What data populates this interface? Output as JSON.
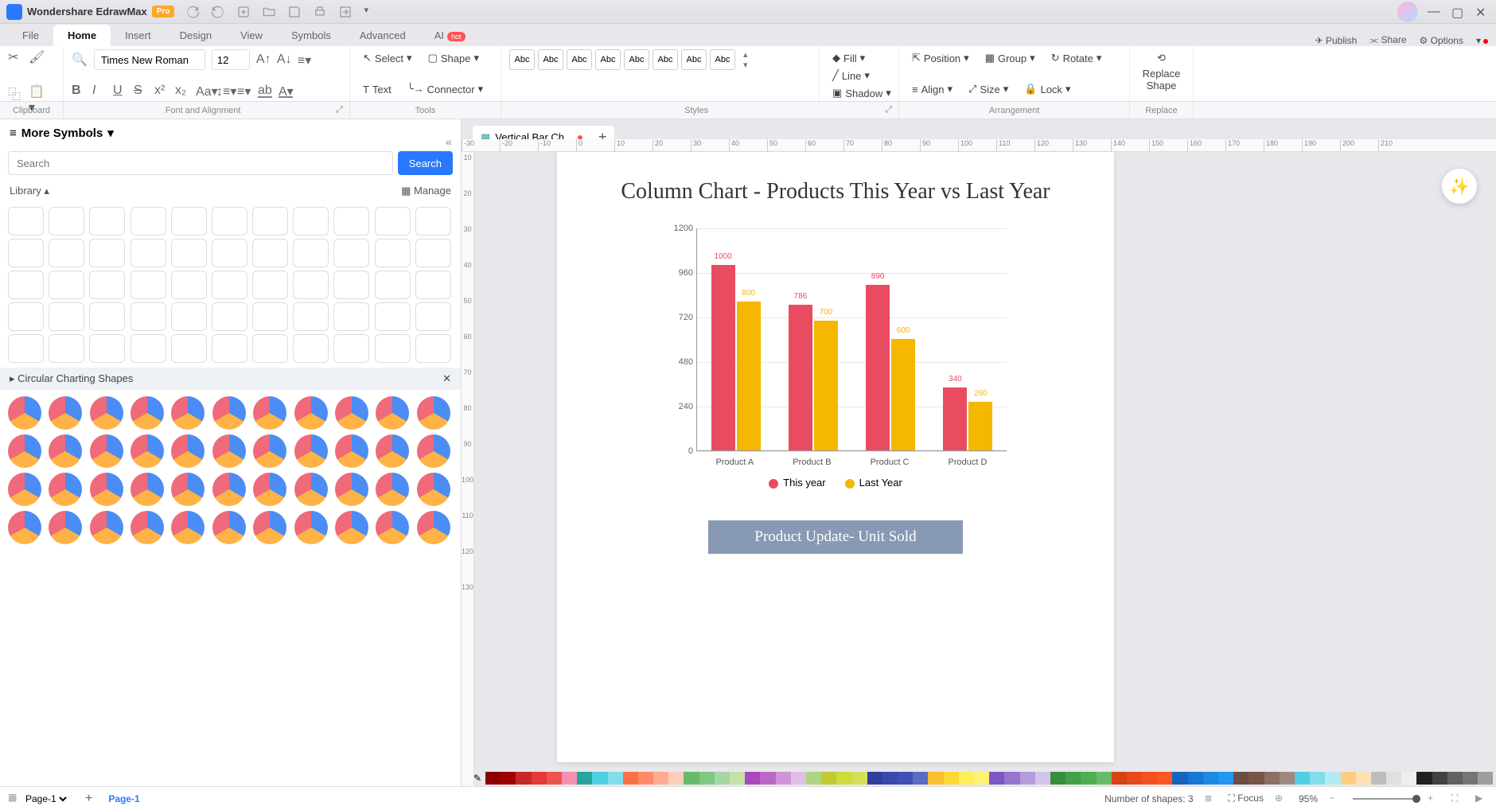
{
  "app": {
    "title": "Wondershare EdrawMax",
    "badge": "Pro"
  },
  "titlebar_actions_right": {
    "publish": "Publish",
    "share": "Share",
    "options": "Options"
  },
  "tabs": {
    "items": [
      "File",
      "Home",
      "Insert",
      "Design",
      "View",
      "Symbols",
      "Advanced",
      "AI"
    ],
    "active": "Home",
    "hot": "hot"
  },
  "ribbon": {
    "font_family": "Times New Roman",
    "font_size": "12",
    "select_label": "Select",
    "shape_label": "Shape",
    "text_label": "Text",
    "connector_label": "Connector",
    "style_box": "Abc",
    "fill": "Fill",
    "line": "Line",
    "shadow": "Shadow",
    "position": "Position",
    "group": "Group",
    "rotate": "Rotate",
    "align": "Align",
    "size": "Size",
    "lock": "Lock",
    "replace_shape": "Replace\nShape"
  },
  "group_labels": [
    "Clipboard",
    "Font and Alignment",
    "Tools",
    "Styles",
    "Arrangement",
    "Replace"
  ],
  "sidebar": {
    "more_symbols": "More Symbols",
    "search_placeholder": "Search",
    "search_btn": "Search",
    "library": "Library",
    "manage": "Manage",
    "section": "Circular Charting Shapes"
  },
  "doc_tab": "Vertical Bar Ch...",
  "ruler_h": [
    "-30",
    "-20",
    "-10",
    "0",
    "10",
    "20",
    "30",
    "40",
    "50",
    "60",
    "70",
    "80",
    "90",
    "100",
    "110",
    "120",
    "130",
    "140",
    "150",
    "160",
    "170",
    "180",
    "190",
    "200",
    "210"
  ],
  "ruler_v": [
    "10",
    "20",
    "30",
    "40",
    "50",
    "60",
    "70",
    "80",
    "90",
    "100",
    "110",
    "120",
    "130"
  ],
  "chart_data": {
    "type": "bar",
    "title": "Column Chart - Products This Year vs Last Year",
    "categories": [
      "Product A",
      "Product B",
      "Product C",
      "Product D"
    ],
    "series": [
      {
        "name": "This year",
        "color": "#e94b61",
        "values": [
          1000,
          786,
          890,
          340
        ]
      },
      {
        "name": "Last Year",
        "color": "#f5b700",
        "values": [
          800,
          700,
          600,
          260
        ]
      }
    ],
    "y_ticks": [
      0,
      240,
      480,
      720,
      960,
      1200
    ],
    "ylim": [
      0,
      1200
    ],
    "subtitle": "Product Update- Unit Sold"
  },
  "color_swatches": [
    "#8b0000",
    "#a00000",
    "#c62828",
    "#e53935",
    "#ef5350",
    "#f48fb1",
    "#26a69a",
    "#4dd0e1",
    "#80deea",
    "#ff7043",
    "#ff8a65",
    "#ffab91",
    "#ffccbc",
    "#66bb6a",
    "#81c784",
    "#a5d6a7",
    "#c5e1a5",
    "#ab47bc",
    "#ba68c8",
    "#ce93d8",
    "#e1bee7",
    "#aed581",
    "#c0ca33",
    "#cddc39",
    "#d4e157",
    "#303f9f",
    "#3949ab",
    "#3f51b5",
    "#5c6bc0",
    "#fbc02d",
    "#fdd835",
    "#ffee58",
    "#fff176",
    "#7e57c2",
    "#9575cd",
    "#b39ddb",
    "#d1c4e9",
    "#388e3c",
    "#43a047",
    "#4caf50",
    "#66bb6a",
    "#d84315",
    "#e64a19",
    "#f4511e",
    "#ff5722",
    "#1565c0",
    "#1976d2",
    "#1e88e5",
    "#2196f3",
    "#6d4c41",
    "#795548",
    "#8d6e63",
    "#a1887f",
    "#4dd0e1",
    "#80deea",
    "#b2ebf2",
    "#ffcc80",
    "#ffe0b2",
    "#bdbdbd",
    "#e0e0e0",
    "#eeeeee",
    "#212121",
    "#424242",
    "#616161",
    "#757575",
    "#9e9e9e"
  ],
  "footer": {
    "page_select": "Page-1",
    "page_tab": "Page-1",
    "shapes_count": "Number of shapes: 3",
    "focus": "Focus",
    "zoom": "95%"
  }
}
